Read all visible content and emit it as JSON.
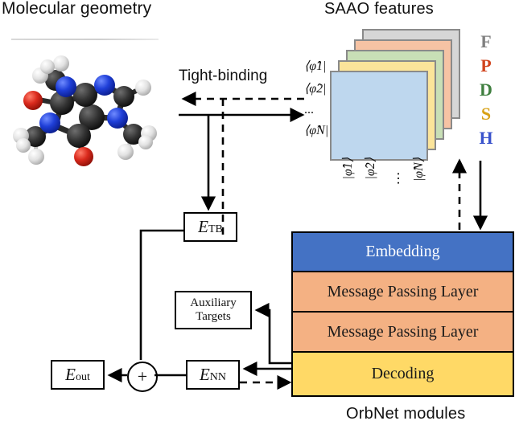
{
  "titles": {
    "molecular_geometry": "Molecular geometry",
    "saao_features": "SAAO features",
    "orbnet_modules": "OrbNet modules",
    "tight_binding": "Tight-binding"
  },
  "molecule": {
    "name": "caffeine-ball-and-stick",
    "atom_colors": {
      "carbon": "#2b2b2b",
      "nitrogen": "#1a3fd4",
      "oxygen": "#d42020",
      "hydrogen": "#efefef"
    }
  },
  "saao": {
    "sheet_colors": [
      "#bed7ee",
      "#fbe49a",
      "#c8dfb6",
      "#f6c3a4",
      "#d6d6d6"
    ],
    "sheet_border": "#8a8a8a",
    "shell_letters": [
      {
        "label": "F",
        "color": "#808080"
      },
      {
        "label": "P",
        "color": "#d1441e"
      },
      {
        "label": "D",
        "color": "#3f7f3f"
      },
      {
        "label": "S",
        "color": "#d8a217"
      },
      {
        "label": "H",
        "color": "#3a53cc"
      }
    ],
    "bra_labels": [
      "⟨φ̂1|",
      "⟨φ̂2|",
      "...",
      "⟨φ̂N|"
    ],
    "ket_labels": [
      "|φ̂1⟩",
      "|φ̂2⟩",
      "|φ̂N⟩"
    ],
    "ket_ellipsis": "⋯"
  },
  "boxes": {
    "e_tb": {
      "base": "E",
      "sub": "TB"
    },
    "e_out": {
      "base": "E",
      "sub": "out"
    },
    "e_nn": {
      "base": "E",
      "sub": "NN"
    },
    "auxiliary_targets": {
      "line1": "Auxiliary",
      "line2": "Targets"
    },
    "plus": "+"
  },
  "modules": [
    {
      "label": "Embedding",
      "fill": "#4472c4",
      "text_color": "#ffffff"
    },
    {
      "label": "Message Passing Layer",
      "fill": "#f4b183",
      "text_color": "#1a1a1a"
    },
    {
      "label": "Message Passing Layer",
      "fill": "#f4b183",
      "text_color": "#1a1a1a"
    },
    {
      "label": "Decoding",
      "fill": "#ffd966",
      "text_color": "#1a1a1a"
    }
  ],
  "flow": {
    "solid_meaning": "forward-pass",
    "dashed_meaning": "gradient-backpropagation",
    "line_color": "#000000"
  }
}
